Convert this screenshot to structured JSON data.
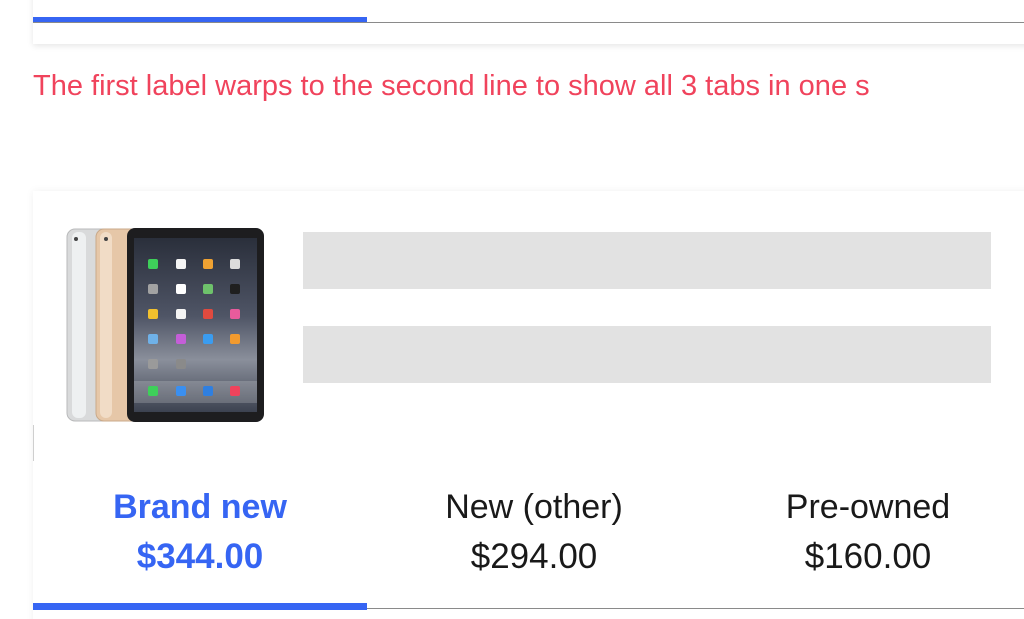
{
  "note": {
    "text": "The first label warps to the second line to show all 3 tabs in one s"
  },
  "product": {
    "image_icon": "tablet-product-icon"
  },
  "tabs": [
    {
      "label": "Brand new",
      "price": "$344.00",
      "active": true
    },
    {
      "label": "New (other)",
      "price": "$294.00",
      "active": false
    },
    {
      "label": "Pre-owned",
      "price": "$160.00",
      "active": false
    }
  ],
  "colors": {
    "accent": "#3665f3",
    "note": "#f0435c",
    "skeleton": "#e2e2e2",
    "text": "#191919"
  }
}
